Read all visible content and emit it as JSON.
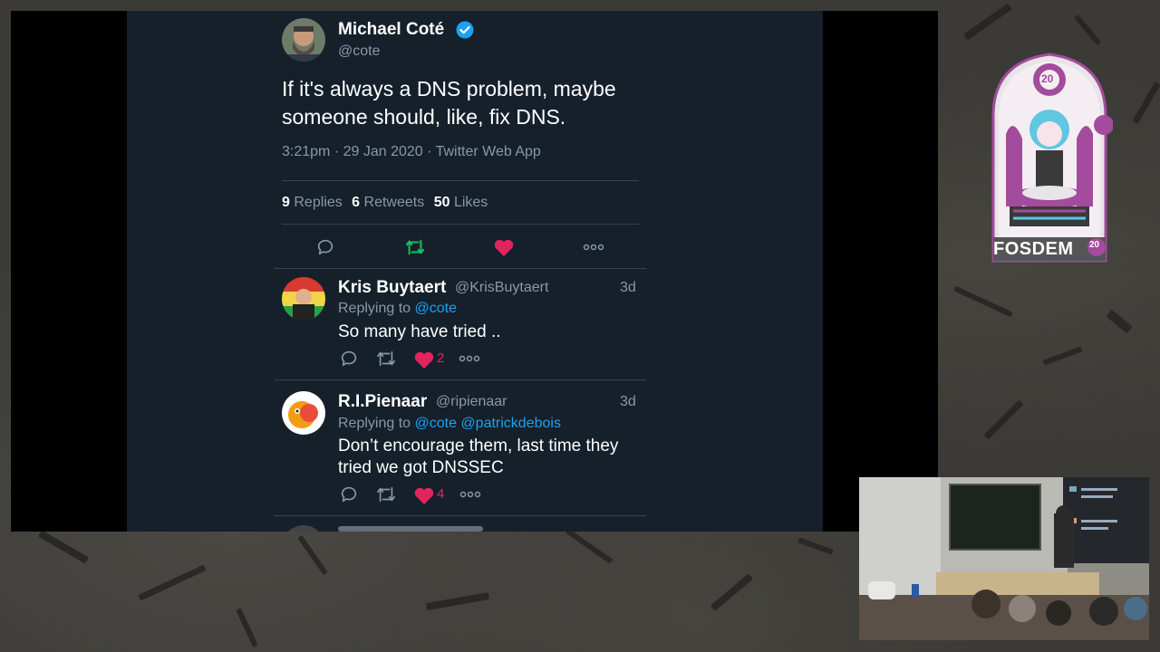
{
  "main_tweet": {
    "author_name": "Michael Coté",
    "author_handle": "@cote",
    "text_line1": "If it's always a DNS problem, maybe",
    "text_line2": "someone should, like, fix DNS.",
    "meta": "3:21pm · 29 Jan 2020 · Twitter Web App",
    "stats": {
      "replies_count": "9",
      "replies_label": "Replies",
      "retweets_count": "6",
      "retweets_label": "Retweets",
      "likes_count": "50",
      "likes_label": "Likes"
    }
  },
  "replies": [
    {
      "name": "Kris Buytaert",
      "handle": "@KrisBuytaert",
      "time": "3d",
      "replying_prefix": "Replying to",
      "mentions": "@cote",
      "text_line1": "So many have tried ..",
      "text_line2": "",
      "like_count": "2"
    },
    {
      "name": "R.I.Pienaar",
      "handle": "@ripienaar",
      "time": "3d",
      "replying_prefix": "Replying to",
      "mentions": "@cote @patrickdebois",
      "text_line1": "Don’t encourage them, last time they",
      "text_line2": "tried we got DNSSEC",
      "like_count": "4"
    }
  ],
  "logo": {
    "text": "FOSDEM",
    "year_top": "20",
    "year_badge": "20"
  },
  "colors": {
    "twitter_bg": "#15202b",
    "accent_blue": "#1da1f2",
    "like_pink": "#e0245e",
    "retweet_green": "#17bf63",
    "muted": "#8899a6",
    "verified": "#1da1f2"
  },
  "icons": [
    "reply-icon",
    "retweet-icon",
    "like-icon",
    "more-icon",
    "verified-badge-icon"
  ]
}
